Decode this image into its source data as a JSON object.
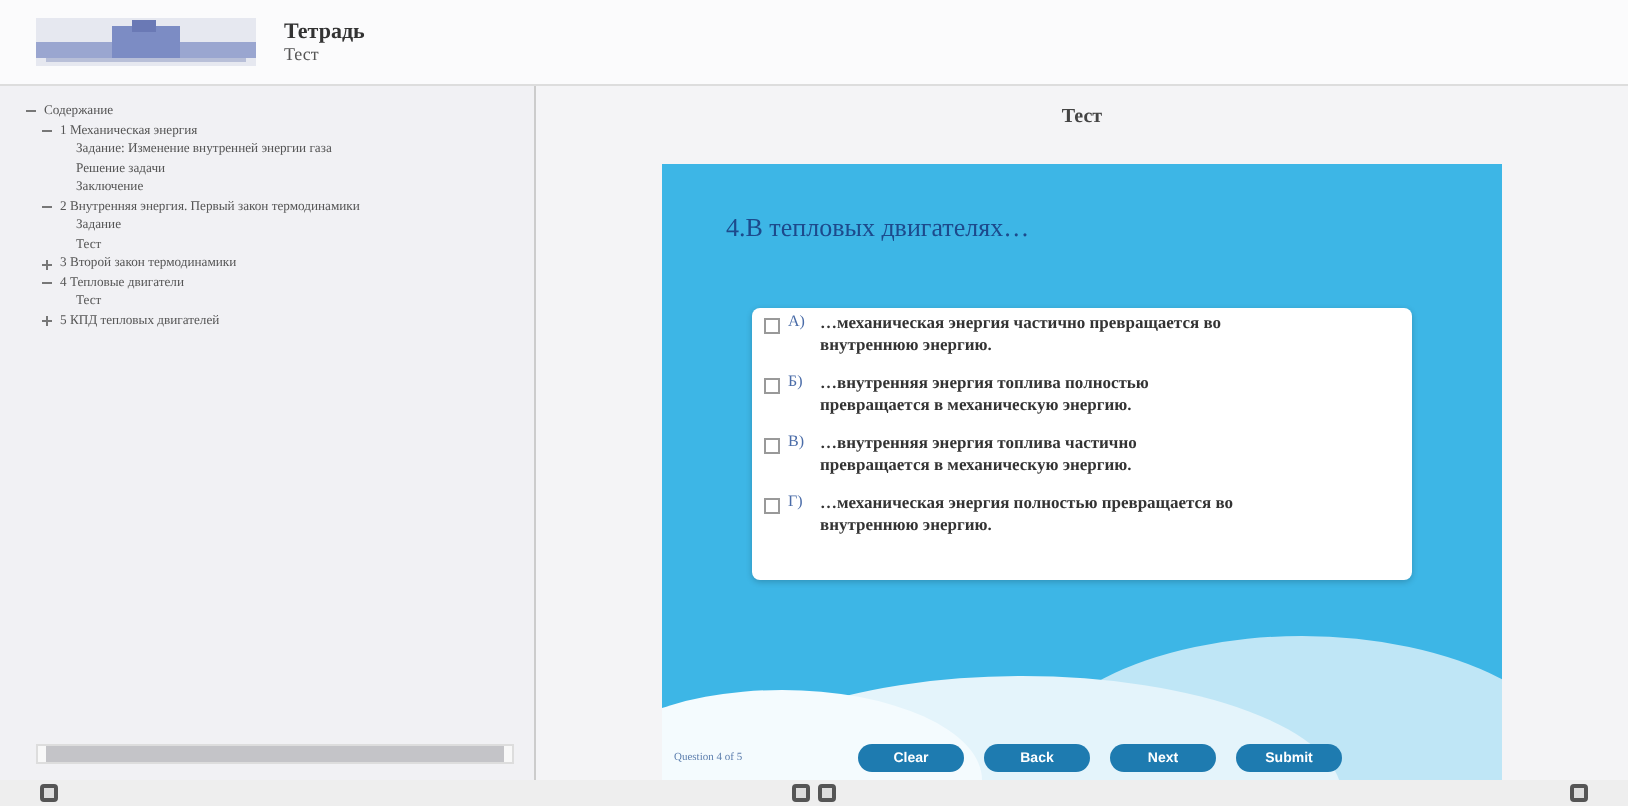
{
  "header": {
    "title": "Тетрадь",
    "subtitle": "Тест"
  },
  "outline": [
    {
      "label": "Содержание",
      "expanded": true,
      "children": [
        {
          "label": "1 Механическая энергия",
          "expanded": true,
          "children": [
            {
              "label": "Задание: Изменение внутренней энергии газа"
            },
            {
              "label": "Решение задачи"
            },
            {
              "label": "Заключение"
            }
          ]
        },
        {
          "label": "2 Внутренняя энергия. Первый закон термодинамики",
          "expanded": true,
          "children": [
            {
              "label": "Задание"
            },
            {
              "label": "Тест"
            }
          ]
        },
        {
          "label": "3 Второй закон термодинамики",
          "expanded": false
        },
        {
          "label": "4 Тепловые двигатели",
          "expanded": true,
          "children": [
            {
              "label": "Тест"
            }
          ]
        },
        {
          "label": "5 КПД тепловых двигателей",
          "expanded": false
        }
      ]
    }
  ],
  "content_title": "Тест",
  "question": "4.В тепловых двигателях…",
  "options": [
    {
      "letter": "А)",
      "text": "…механическая энергия частично превращается во внутреннюю энергию.",
      "checked": false
    },
    {
      "letter": "Б)",
      "text": "…внутренняя энергия топлива полностью превращается в механическую энергию.",
      "checked": false
    },
    {
      "letter": "В)",
      "text": "…внутренняя энергия топлива частично превращается в механическую энергию.",
      "checked": false
    },
    {
      "letter": "Г)",
      "text": "…механическая энергия полностью превращается во внутреннюю энергию.",
      "checked": false
    }
  ],
  "progress": "Question 4 of 5",
  "buttons": [
    "Clear",
    "Back",
    "Next",
    "Submit"
  ]
}
